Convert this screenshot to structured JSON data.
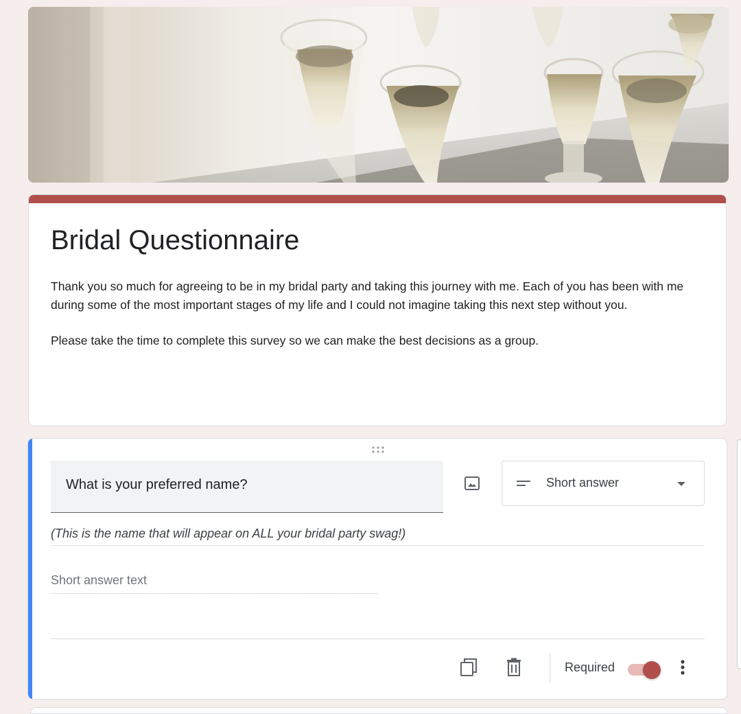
{
  "header": {
    "image_name": "champagne-glasses-banner"
  },
  "form": {
    "title": "Bridal Questionnaire",
    "description": [
      "Thank you so much for agreeing to be in my bridal party and taking this journey with me. Each of you has been with me during some of the most important stages of my life and I could not imagine taking this next step without you.",
      "Please take the time to complete this survey so we can make the best decisions as a group."
    ],
    "accent_color": "#b14f4d"
  },
  "question": {
    "title": "What is your preferred name?",
    "type": "Short answer",
    "description": "(This is the name that will appear on ALL your bridal party swag!)",
    "answer_placeholder": "Short answer text",
    "required_label": "Required",
    "required": true,
    "active_color": "#4285f4",
    "icons": [
      "drag-handle-icon",
      "image-icon",
      "short-answer-icon",
      "dropdown-arrow-icon",
      "copy-icon",
      "trash-icon",
      "more-vert-icon"
    ]
  }
}
